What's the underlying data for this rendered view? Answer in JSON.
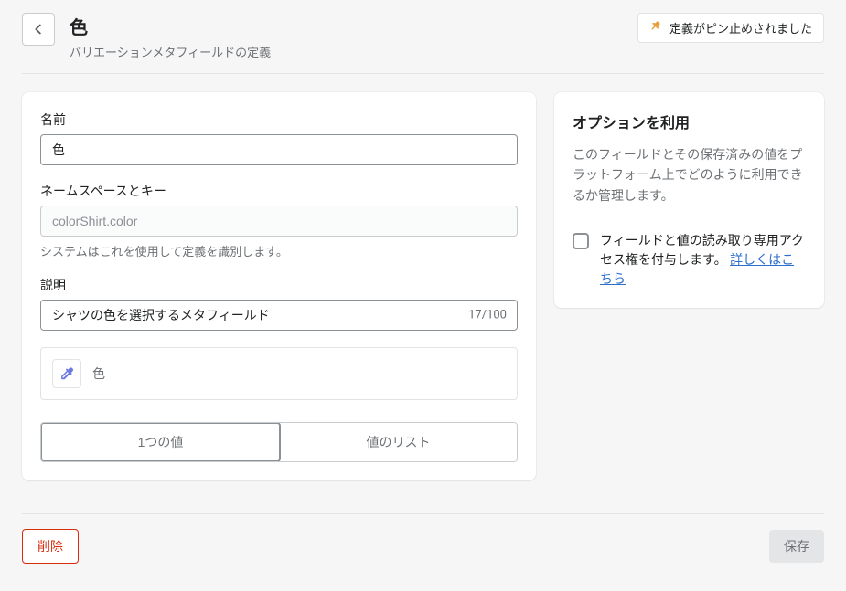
{
  "header": {
    "title": "色",
    "subtitle": "バリエーションメタフィールドの定義",
    "pin_label": "定義がピン止めされました"
  },
  "form": {
    "name_label": "名前",
    "name_value": "色",
    "namespace_label": "ネームスペースとキー",
    "namespace_value": "colorShirt.color",
    "namespace_help": "システムはこれを使用して定義を識別します。",
    "description_label": "説明",
    "description_value": "シャツの色を選択するメタフィールド",
    "description_counter": "17/100",
    "type_label": "色",
    "segment_single": "1つの値",
    "segment_list": "値のリスト"
  },
  "side": {
    "title": "オプションを利用",
    "desc": "このフィールドとその保存済みの値をプラットフォーム上でどのように利用できるか管理します。",
    "checkbox_label": "フィールドと値の読み取り専用アクセス権を付与します。",
    "link_label": "詳しくはこちら"
  },
  "footer": {
    "delete": "削除",
    "save": "保存"
  }
}
